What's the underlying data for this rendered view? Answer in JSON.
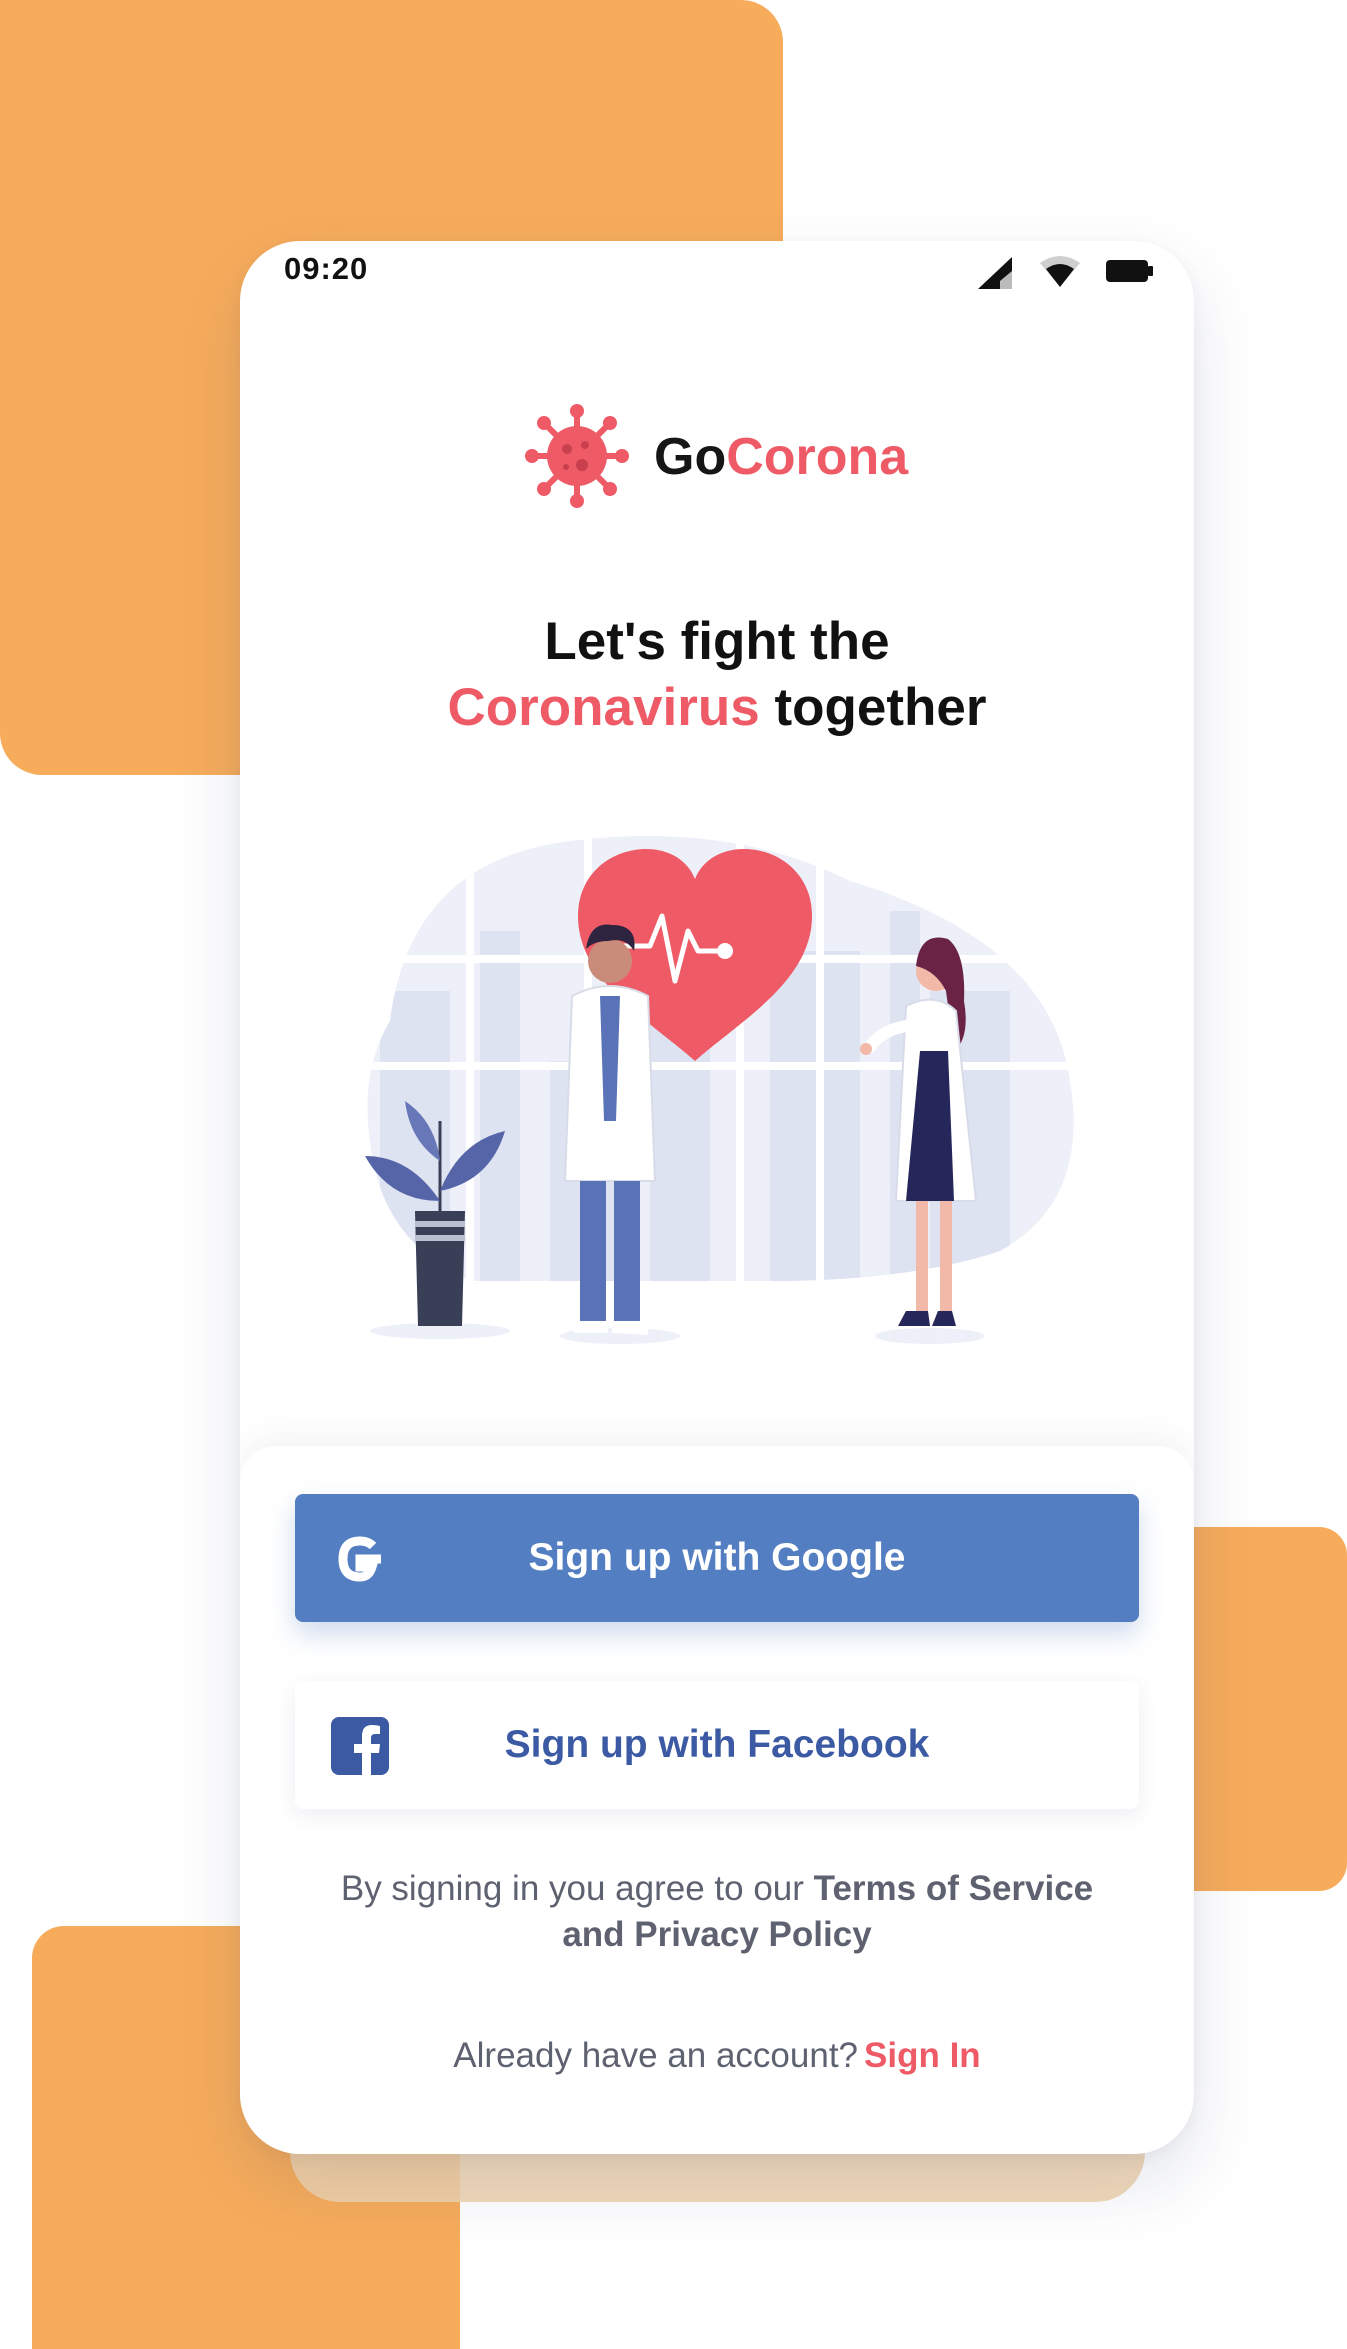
{
  "colors": {
    "accent": "#EE5B67",
    "decor": "#F6AC5B",
    "google_button": "#547EC2",
    "facebook_text": "#3B5AA3",
    "muted_text": "#5E6270"
  },
  "status_bar": {
    "time": "09:20",
    "icons": [
      "signal-icon",
      "wifi-icon",
      "battery-icon"
    ]
  },
  "logo": {
    "icon": "virus-icon",
    "word_1": "Go",
    "word_2": "Corona"
  },
  "headline": {
    "line_1": "Let's fight the",
    "accent": "Coronavirus",
    "rest": "together"
  },
  "illustration": {
    "icon": "doctors-heart-illustration"
  },
  "buttons": {
    "google": {
      "label": "Sign up with Google",
      "icon": "google-icon"
    },
    "facebook": {
      "label": "Sign up with Facebook",
      "icon": "facebook-icon"
    }
  },
  "terms": {
    "prefix": "By signing in you agree to our",
    "link": "Terms of Service and Privacy Policy"
  },
  "signin": {
    "prompt": "Already have an account?",
    "link": "Sign In"
  }
}
